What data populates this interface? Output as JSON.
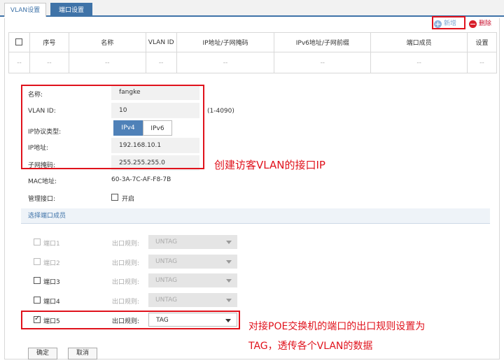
{
  "tabs": [
    {
      "label": "VLAN设置"
    },
    {
      "label": "端口设置"
    }
  ],
  "toolbar": {
    "add_label": "新增",
    "delete_label": "删除"
  },
  "table": {
    "headers": [
      "",
      "序号",
      "名称",
      "VLAN ID",
      "IP地址/子网掩码",
      "IPv6地址/子网前缀",
      "端口成员",
      "设置"
    ],
    "row": [
      "--",
      "--",
      "--",
      "--",
      "--",
      "--",
      "--",
      "--"
    ]
  },
  "form": {
    "name_label": "名称:",
    "name_value": "fangke",
    "vlan_id_label": "VLAN ID:",
    "vlan_id_value": "10",
    "vlan_id_range": "(1-4090)",
    "ip_proto_label": "IP协议类型:",
    "ip_proto_options": [
      "IPv4",
      "IPv6"
    ],
    "ip_proto_selected": "IPv4",
    "ip_label": "IP地址:",
    "ip_value": "192.168.10.1",
    "mask_label": "子网掩码:",
    "mask_value": "255.255.255.0",
    "mac_label": "MAC地址:",
    "mac_value": "60-3A-7C-AF-F8-7B",
    "mgmt_label": "管理接口:",
    "mgmt_option": "开启",
    "mgmt_checked": false
  },
  "ports_section": {
    "title": "选择端口成员"
  },
  "ports": [
    {
      "name": "端口1",
      "rule_label": "出口规则:",
      "rule": "UNTAG",
      "checked": false,
      "disabled": true
    },
    {
      "name": "端口2",
      "rule_label": "出口规则:",
      "rule": "UNTAG",
      "checked": false,
      "disabled": true
    },
    {
      "name": "端口3",
      "rule_label": "出口规则:",
      "rule": "UNTAG",
      "checked": false,
      "disabled": false
    },
    {
      "name": "端口4",
      "rule_label": "出口规则:",
      "rule": "UNTAG",
      "checked": false,
      "disabled": false
    },
    {
      "name": "端口5",
      "rule_label": "出口规则:",
      "rule": "TAG",
      "checked": true,
      "disabled": false
    }
  ],
  "buttons": {
    "ok": "确定",
    "cancel": "取消"
  },
  "annotations": {
    "ip_note": "创建访客VLAN的接口IP",
    "port_note_line1": "对接POE交换机的端口的出口规则设置为",
    "port_note_line2": "TAG，透传各个VLAN的数据"
  },
  "colors": {
    "accent": "#3f73a8",
    "annotation": "#e0121c"
  }
}
